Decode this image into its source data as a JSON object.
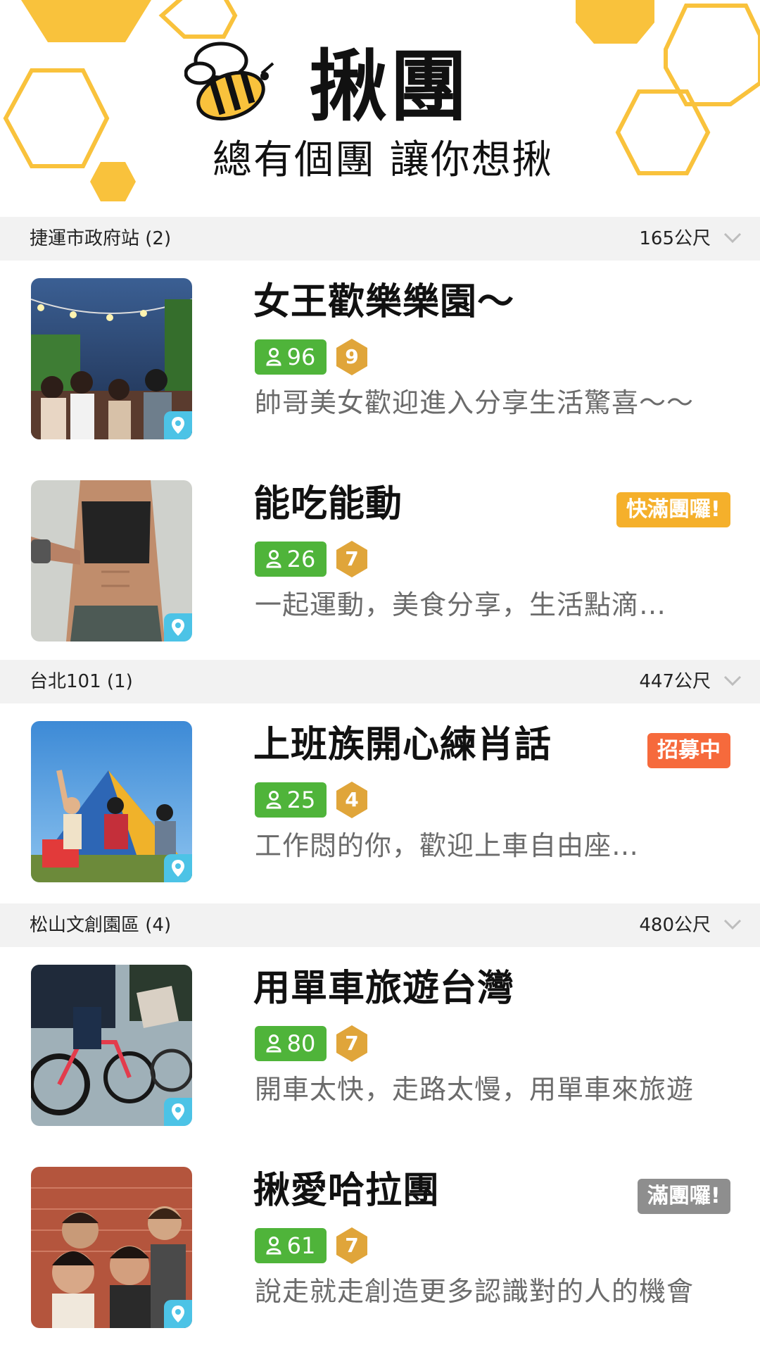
{
  "app": {
    "title": "揪團",
    "tagline": "總有個團 讓你想揪"
  },
  "colors": {
    "honey": "#f9c23c",
    "member_green": "#4fb43a",
    "level_gold": "#e0a53a",
    "pin_blue": "#4cc3e6",
    "badge_almost_full": "#f5b02b",
    "badge_recruiting": "#f66a3c",
    "badge_full": "#8e8e8e"
  },
  "sections": [
    {
      "name": "捷運市政府站 (2)",
      "distance": "165公尺",
      "groups": [
        {
          "name": "女王歡樂樂園～",
          "members": "96",
          "level": "9",
          "description": "帥哥美女歡迎進入分享生活驚喜～～",
          "badge": "",
          "icon": "location-pin-icon"
        },
        {
          "name": "能吃能動",
          "members": "26",
          "level": "7",
          "description": "一起運動，美食分享，生活點滴…",
          "badge": "快滿團囉!",
          "icon": "location-pin-icon"
        }
      ]
    },
    {
      "name": "台北101 (1)",
      "distance": "447公尺",
      "groups": [
        {
          "name": "上班族開心練肖話",
          "members": "25",
          "level": "4",
          "description": "工作悶的你，歡迎上車自由座…",
          "badge": "招募中",
          "icon": "location-pin-icon"
        }
      ]
    },
    {
      "name": "松山文創園區 (4)",
      "distance": "480公尺",
      "groups": [
        {
          "name": "用單車旅遊台灣",
          "members": "80",
          "level": "7",
          "description": "開車太快，走路太慢，用單車來旅遊",
          "badge": "",
          "icon": "location-pin-icon"
        },
        {
          "name": "揪愛哈拉團",
          "members": "61",
          "level": "7",
          "description": "說走就走創造更多認識對的人的機會",
          "badge": "滿團囉!",
          "icon": "location-pin-icon"
        }
      ]
    }
  ]
}
